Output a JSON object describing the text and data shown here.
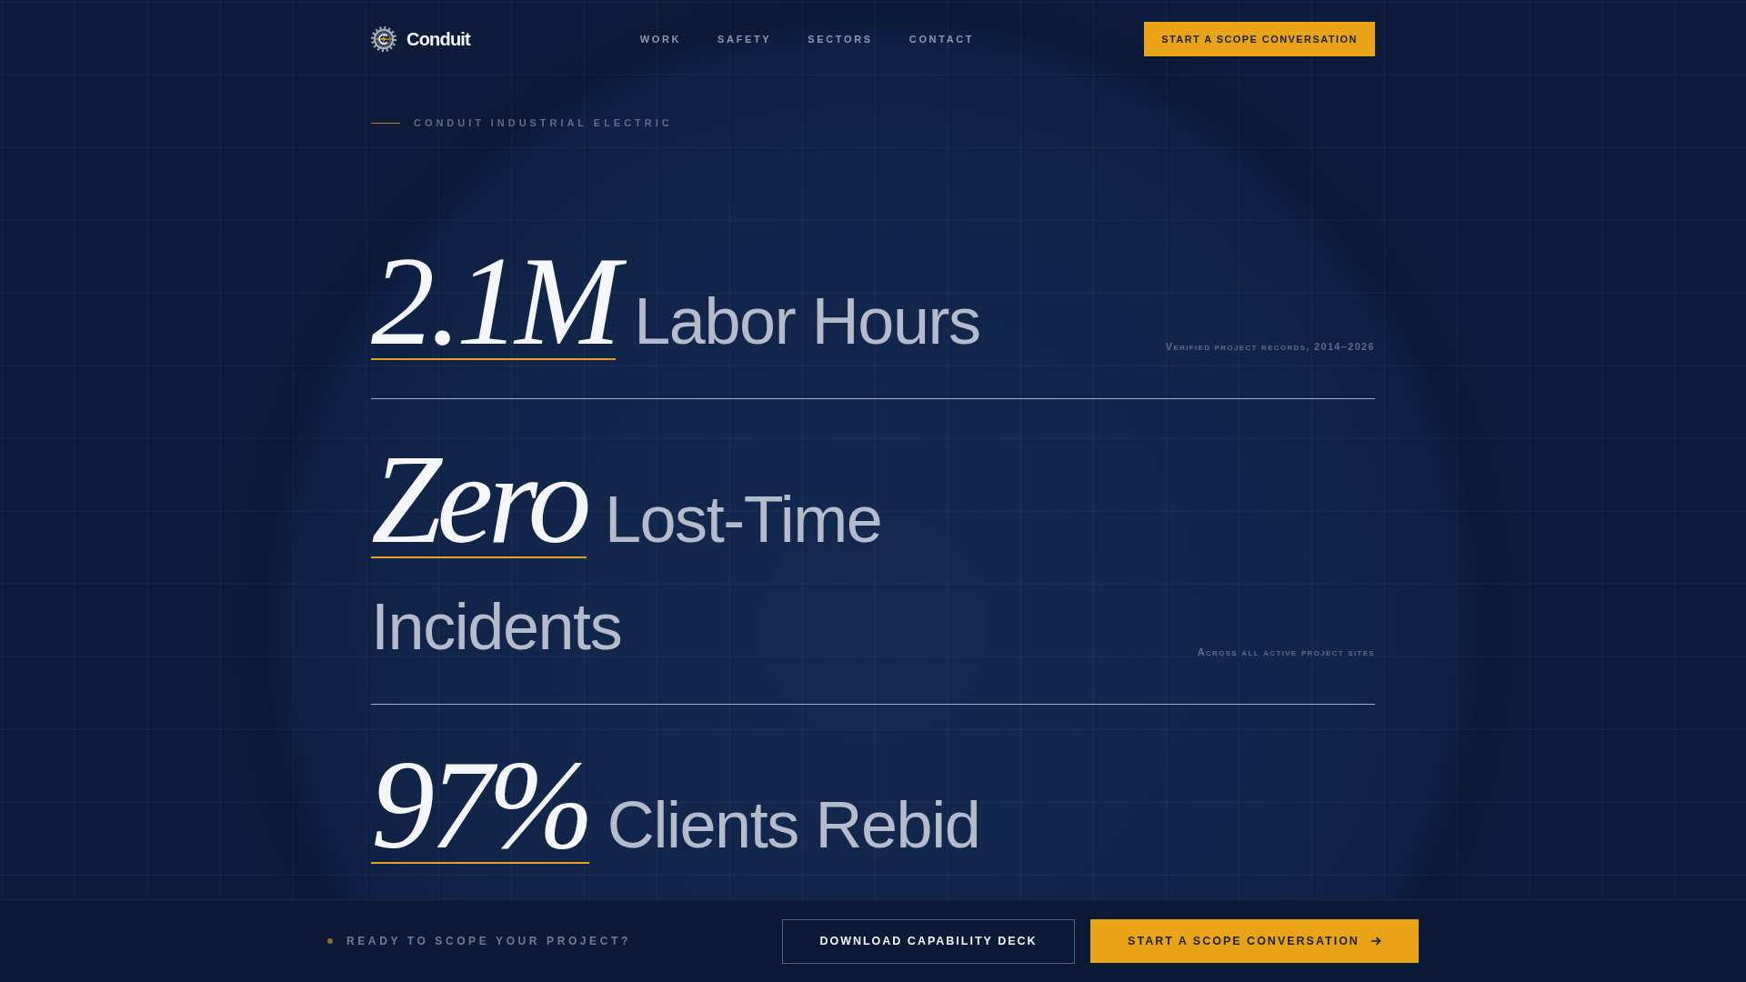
{
  "header": {
    "brand": "Conduit",
    "nav": [
      "WORK",
      "SAFETY",
      "SECTORS",
      "CONTACT"
    ],
    "cta": "START A SCOPE CONVERSATION"
  },
  "eyebrow": "CONDUIT INDUSTRIAL ELECTRIC",
  "stats": [
    {
      "figure": "2.1M",
      "label": "Labor Hours",
      "caption": "Verified project records, 2014–2026"
    },
    {
      "figure": "Zero",
      "label": "Lost-Time Incidents",
      "caption": "Across all active project sites"
    },
    {
      "figure": "97%",
      "label": "Clients Rebid"
    }
  ],
  "cta_bar": {
    "prompt": "READY TO SCOPE YOUR PROJECT?",
    "buttons": [
      {
        "kind": "outline",
        "label": "DOWNLOAD CAPABILITY DECK"
      },
      {
        "kind": "solid",
        "label": "START A SCOPE CONVERSATION"
      }
    ]
  }
}
